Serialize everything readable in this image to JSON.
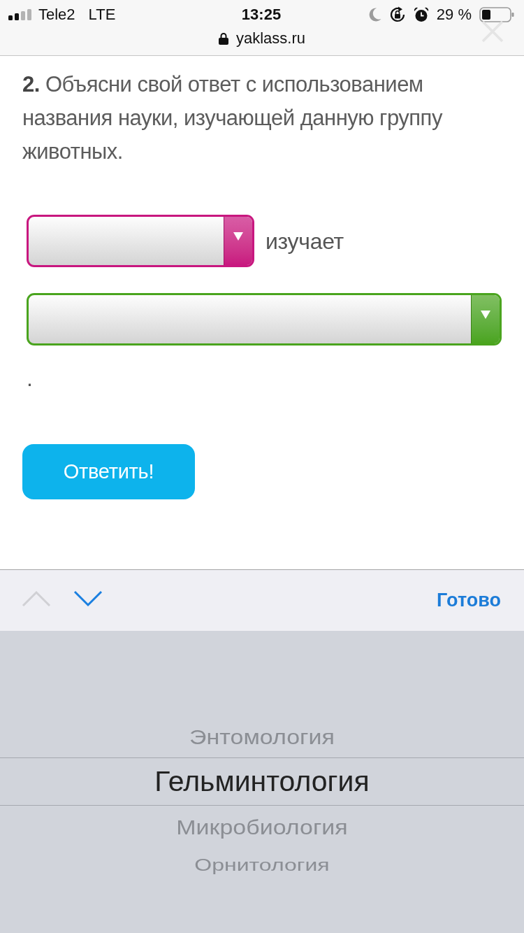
{
  "status_bar": {
    "carrier": "Tele2",
    "network": "LTE",
    "time": "13:25",
    "battery": "29 %"
  },
  "address_bar": {
    "url": "yaklass.ru"
  },
  "question": {
    "text": "**2.** Объясни свой ответ с использованием названия науки, изучающей данную группу животных."
  },
  "answer": {
    "lines": [
      {
        "items": [
          {
            "kind": "select",
            "color": "#c8177f"
          },
          {
            "kind": "text",
            "text": "изучает"
          }
        ]
      },
      {
        "items": [
          {
            "kind": "select",
            "color": "#4aa41e"
          }
        ]
      },
      {
        "items": [
          {
            "kind": "text",
            "text": "."
          }
        ]
      }
    ]
  },
  "submit_button": {
    "label": "Ответить!"
  },
  "keyboard_toolbar": {
    "previous": {
      "disabled": true
    },
    "next": {
      "disabled": false
    },
    "done": "Готово"
  },
  "picker": {
    "options": [
      {
        "label": "Энтомология",
        "selected": false
      },
      {
        "label": "Гельминтология",
        "selected": true
      },
      {
        "label": "Микробиология",
        "selected": false
      },
      {
        "label": "Орнитология",
        "selected": false
      }
    ]
  }
}
